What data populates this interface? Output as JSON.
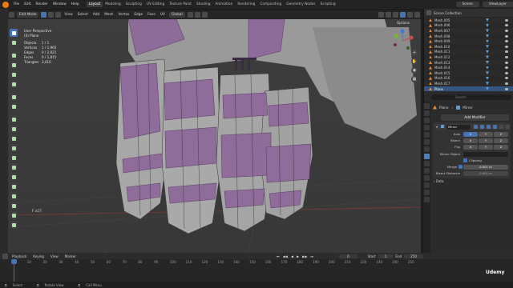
{
  "topbar": {
    "menus": [
      "File",
      "Edit",
      "Render",
      "Window",
      "Help"
    ],
    "workspaces": [
      "Layout",
      "Modeling",
      "Sculpting",
      "UV Editing",
      "Texture Paint",
      "Shading",
      "Animation",
      "Rendering",
      "Compositing",
      "Geometry Nodes",
      "Scripting"
    ],
    "active_workspace": "Layout",
    "scene": "Scene",
    "view_layer": "ViewLayer"
  },
  "viewport_header": {
    "mode": "Edit Mode",
    "menus": [
      "View",
      "Select",
      "Add",
      "Mesh",
      "Vertex",
      "Edge",
      "Face",
      "UV"
    ],
    "orientation": "Global",
    "options": "Options"
  },
  "viewport_info": {
    "perspective": "User Perspective",
    "object": "(0) Plane",
    "stats": [
      {
        "k": "Objects",
        "v": "1 / 1"
      },
      {
        "k": "Vertices",
        "v": "1 / 1,965"
      },
      {
        "k": "Edges",
        "v": "0 / 2,821"
      },
      {
        "k": "Faces",
        "v": "0 / 1,815"
      },
      {
        "k": "Triangles",
        "v": "3,410"
      }
    ]
  },
  "fx_label": "F x17",
  "outliner": {
    "header": "Scene Collection",
    "items": [
      "Mesh.005",
      "Mesh.006",
      "Mesh.007",
      "Mesh.008",
      "Mesh.009",
      "Mesh.010",
      "Mesh.011",
      "Mesh.012",
      "Mesh.013",
      "Mesh.014",
      "Mesh.015",
      "Mesh.016",
      "Mesh.017",
      "Plane",
      "Sphere"
    ],
    "selected": "Plane"
  },
  "properties": {
    "search_placeholder": "Search",
    "object_name": "Plane",
    "modifier_tag": "Mirror",
    "add_modifier": "Add Modifier",
    "modifier_name": "Mirror",
    "axis_label": "Axis",
    "bisect_label": "Bisect",
    "flip_label": "Flip",
    "axes": [
      "X",
      "Y",
      "Z"
    ],
    "mirror_object_label": "Mirror Object",
    "clipping_label": "Clipping",
    "merge_label": "Merge",
    "merge_value": "0.001 m",
    "bisect_distance_label": "Bisect Distance",
    "bisect_distance_value": "0.001 m",
    "data_label": "Data"
  },
  "timeline": {
    "menus": [
      "Playback",
      "Keying",
      "View",
      "Marker"
    ],
    "current_frame": "0",
    "start_label": "Start",
    "start": "1",
    "end_label": "End",
    "end": "250",
    "ticks": [
      "0",
      "10",
      "20",
      "30",
      "40",
      "50",
      "60",
      "70",
      "80",
      "90",
      "100",
      "110",
      "120",
      "130",
      "140",
      "150",
      "160",
      "170",
      "180",
      "190",
      "200",
      "210",
      "220",
      "230",
      "240",
      "250"
    ]
  },
  "statusbar": {
    "items": [
      "Select",
      "Rotate View",
      "Call Menu"
    ]
  },
  "watermark": "Udemy"
}
